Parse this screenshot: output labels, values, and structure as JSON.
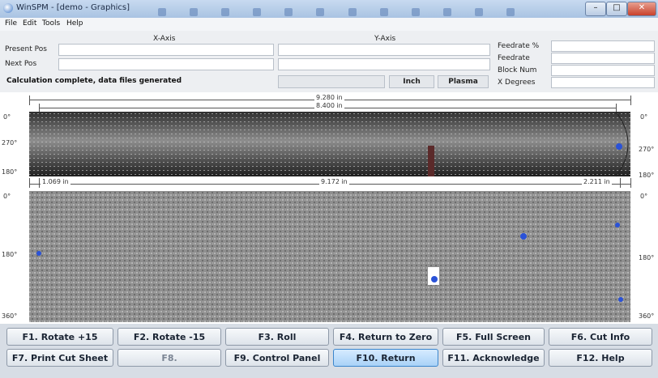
{
  "window": {
    "title": "WinSPM - [demo - Graphics]"
  },
  "menu": {
    "items": [
      "File",
      "Edit",
      "Tools",
      "Help"
    ]
  },
  "info": {
    "x_axis_label": "X-Axis",
    "y_axis_label": "Y-Axis",
    "present_pos_label": "Present Pos",
    "next_pos_label": "Next Pos",
    "status": "Calculation complete, data files generated",
    "unit": "Inch",
    "mode": "Plasma",
    "feedrate_pct_label": "Feedrate %",
    "feedrate_label": "Feedrate",
    "block_num_label": "Block Num",
    "x_degrees_label": "X Degrees"
  },
  "graphics": {
    "top_view": {
      "dim_overall": "9.280 in",
      "dim_inner": "8.400 in",
      "angle_labels": [
        "0°",
        "270°",
        "180°"
      ],
      "angle_labels_right": [
        "0°",
        "270°",
        "180°"
      ]
    },
    "unrolled_view": {
      "dim_left": "1.069 in",
      "dim_middle": "9.172 in",
      "dim_right": "2.211 in",
      "angle_labels": [
        "0°",
        "180°",
        "360°"
      ],
      "angle_labels_right": [
        "0°",
        "180°",
        "360°"
      ]
    }
  },
  "buttons": {
    "f1": "F1. Rotate +15",
    "f2": "F2. Rotate -15",
    "f3": "F3. Roll",
    "f4": "F4. Return to Zero",
    "f5": "F5. Full Screen",
    "f6": "F6. Cut Info",
    "f7": "F7. Print Cut Sheet",
    "f8": "F8.",
    "f9": "F9. Control Panel",
    "f10": "F10. Return",
    "f11": "F11. Acknowledge",
    "f12": "F12. Help"
  },
  "colors": {
    "pipe_dark": "#3a3a3a",
    "pipe_light": "#9a9a9a",
    "marker": "#2a52d8",
    "active_button": "#a9d2f7"
  }
}
